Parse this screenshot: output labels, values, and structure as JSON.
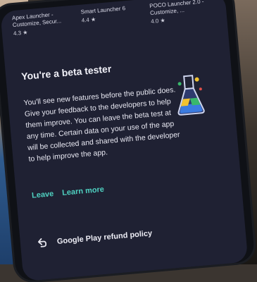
{
  "apps": [
    {
      "name": "Apex Launcher - Customize, Secur...",
      "rating": "4.3 ★"
    },
    {
      "name": "Smart Launcher 6",
      "rating": "4.4 ★"
    },
    {
      "name": "POCO Launcher 2.0 - Customize, ...",
      "rating": "4.0 ★"
    }
  ],
  "beta": {
    "title": "You're a beta tester",
    "body": "You'll see new features before the public does. Give your feedback to the developers to help them improve. You can leave the beta test at any time. Certain data on your use of the app will be collected and shared with the developer to help improve the app.",
    "leave_label": "Leave",
    "learn_more_label": "Learn more"
  },
  "refund": {
    "label": "Google Play refund policy"
  },
  "colors": {
    "accent": "#4fd1c1",
    "screen_bg": "#1f2133"
  },
  "icons": {
    "flask": "beta-flask-icon",
    "refund": "refund-arrow-icon"
  }
}
